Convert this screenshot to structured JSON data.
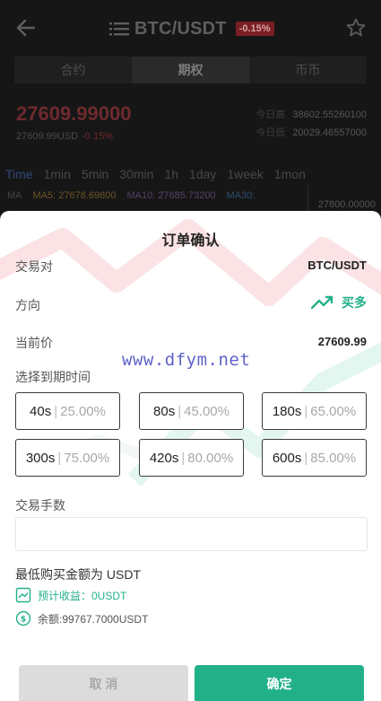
{
  "header": {
    "pair": "BTC/USDT",
    "change_badge": "-0.15%"
  },
  "tabs": [
    {
      "label": "合约",
      "active": false
    },
    {
      "label": "期权",
      "active": true
    },
    {
      "label": "币币",
      "active": false
    }
  ],
  "ticker": {
    "last_price": "27609.99000",
    "sub_price": "27609.99USD",
    "sub_change": "-0.15%",
    "high_label": "今日高",
    "high_value": "38602.55260100",
    "low_label": "今日低",
    "low_value": "20029.46557000"
  },
  "periods": [
    "Time",
    "1min",
    "5min",
    "30min",
    "1h",
    "1day",
    "1week",
    "1mon"
  ],
  "ma": {
    "ma_label": "MA",
    "ma5": "MA5: 27678.69800",
    "ma10": "MA10: 27685.73200",
    "ma30": "MA30:",
    "axis_price": "27800.00000"
  },
  "order_sheet": {
    "title": "订单确认",
    "pair_label": "交易对",
    "pair_value": "BTC/USDT",
    "direction_label": "方向",
    "direction_value": "买多",
    "current_price_label": "当前价",
    "current_price_value": "27609.99",
    "watermark": "www.dfym.net",
    "expiry_label": "选择到期时间",
    "expiry_options": [
      {
        "duration": "40s",
        "rate": "25.00%"
      },
      {
        "duration": "80s",
        "rate": "45.00%"
      },
      {
        "duration": "180s",
        "rate": "65.00%"
      },
      {
        "duration": "300s",
        "rate": "75.00%"
      },
      {
        "duration": "420s",
        "rate": "80.00%"
      },
      {
        "duration": "600s",
        "rate": "85.00%"
      }
    ],
    "amount_label": "交易手数",
    "amount_value": "",
    "min_buy": "最低购买金额为 USDT",
    "expected_profit": "预计收益：0USDT",
    "balance": "余额:99767.7000USDT",
    "cancel_label": "取 消",
    "confirm_label": "确定"
  },
  "colors": {
    "accent_green": "#22b089",
    "negative_red": "#e03a44",
    "watermark_blue": "#5f63c8"
  },
  "icons": {
    "back": "arrow-left-icon",
    "menu": "list-icon",
    "favorite": "star-icon",
    "direction": "trending-up-icon",
    "profit": "chart-up-icon",
    "balance": "coin-icon"
  }
}
